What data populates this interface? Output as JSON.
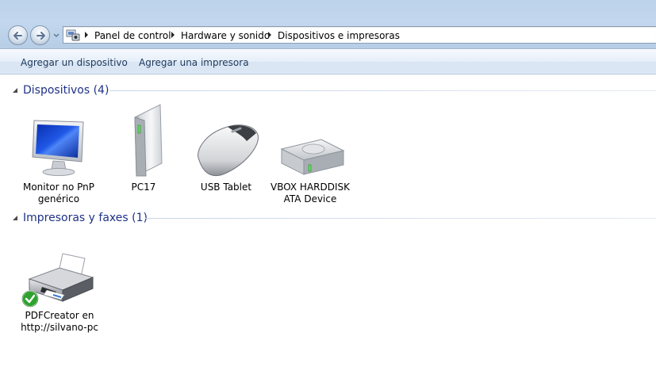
{
  "breadcrumb": {
    "items": [
      "Panel de control",
      "Hardware y sonido",
      "Dispositivos e impresoras"
    ]
  },
  "toolbar": {
    "add_device": "Agregar un dispositivo",
    "add_printer": "Agregar una impresora"
  },
  "groups": {
    "devices": {
      "title": "Dispositivos (4)",
      "items": [
        {
          "label": "Monitor no PnP\ngenérico",
          "icon": "monitor-icon"
        },
        {
          "label": "PC17",
          "icon": "computer-tower-icon"
        },
        {
          "label": "USB Tablet",
          "icon": "mouse-icon"
        },
        {
          "label": "VBOX HARDDISK\nATA Device",
          "icon": "hard-disk-icon"
        }
      ]
    },
    "printers": {
      "title": "Impresoras y faxes (1)",
      "items": [
        {
          "label": "PDFCreator en\nhttp://silvano-pc",
          "icon": "printer-icon",
          "default": true
        }
      ]
    }
  },
  "colors": {
    "group_title": "#1e3287",
    "command_text": "#1e395b",
    "default_check": "#2fa12f"
  }
}
